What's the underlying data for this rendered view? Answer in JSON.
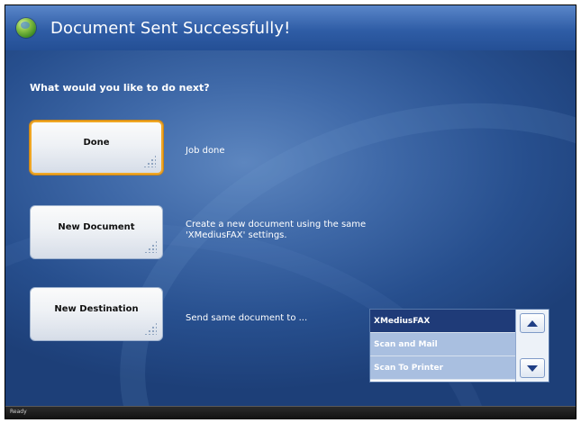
{
  "header": {
    "title": "Document Sent Successfully!",
    "icon": "globe-icon"
  },
  "prompt": "What would you like to do next?",
  "actions": [
    {
      "label": "Done",
      "description": "Job done"
    },
    {
      "label": "New Document",
      "description_line1": "Create a new document using the same",
      "description_line2": "'XMediusFAX' settings."
    },
    {
      "label": "New Destination",
      "description": "Send same document to ..."
    }
  ],
  "destinations": {
    "items": [
      "XMediusFAX",
      "Scan and Mail",
      "Scan To Printer"
    ],
    "selected": "XMediusFAX"
  },
  "status": "Ready",
  "colors": {
    "background": "#3f69a8",
    "focus_border": "#f0a623",
    "selected_item": "#1f3b78"
  }
}
